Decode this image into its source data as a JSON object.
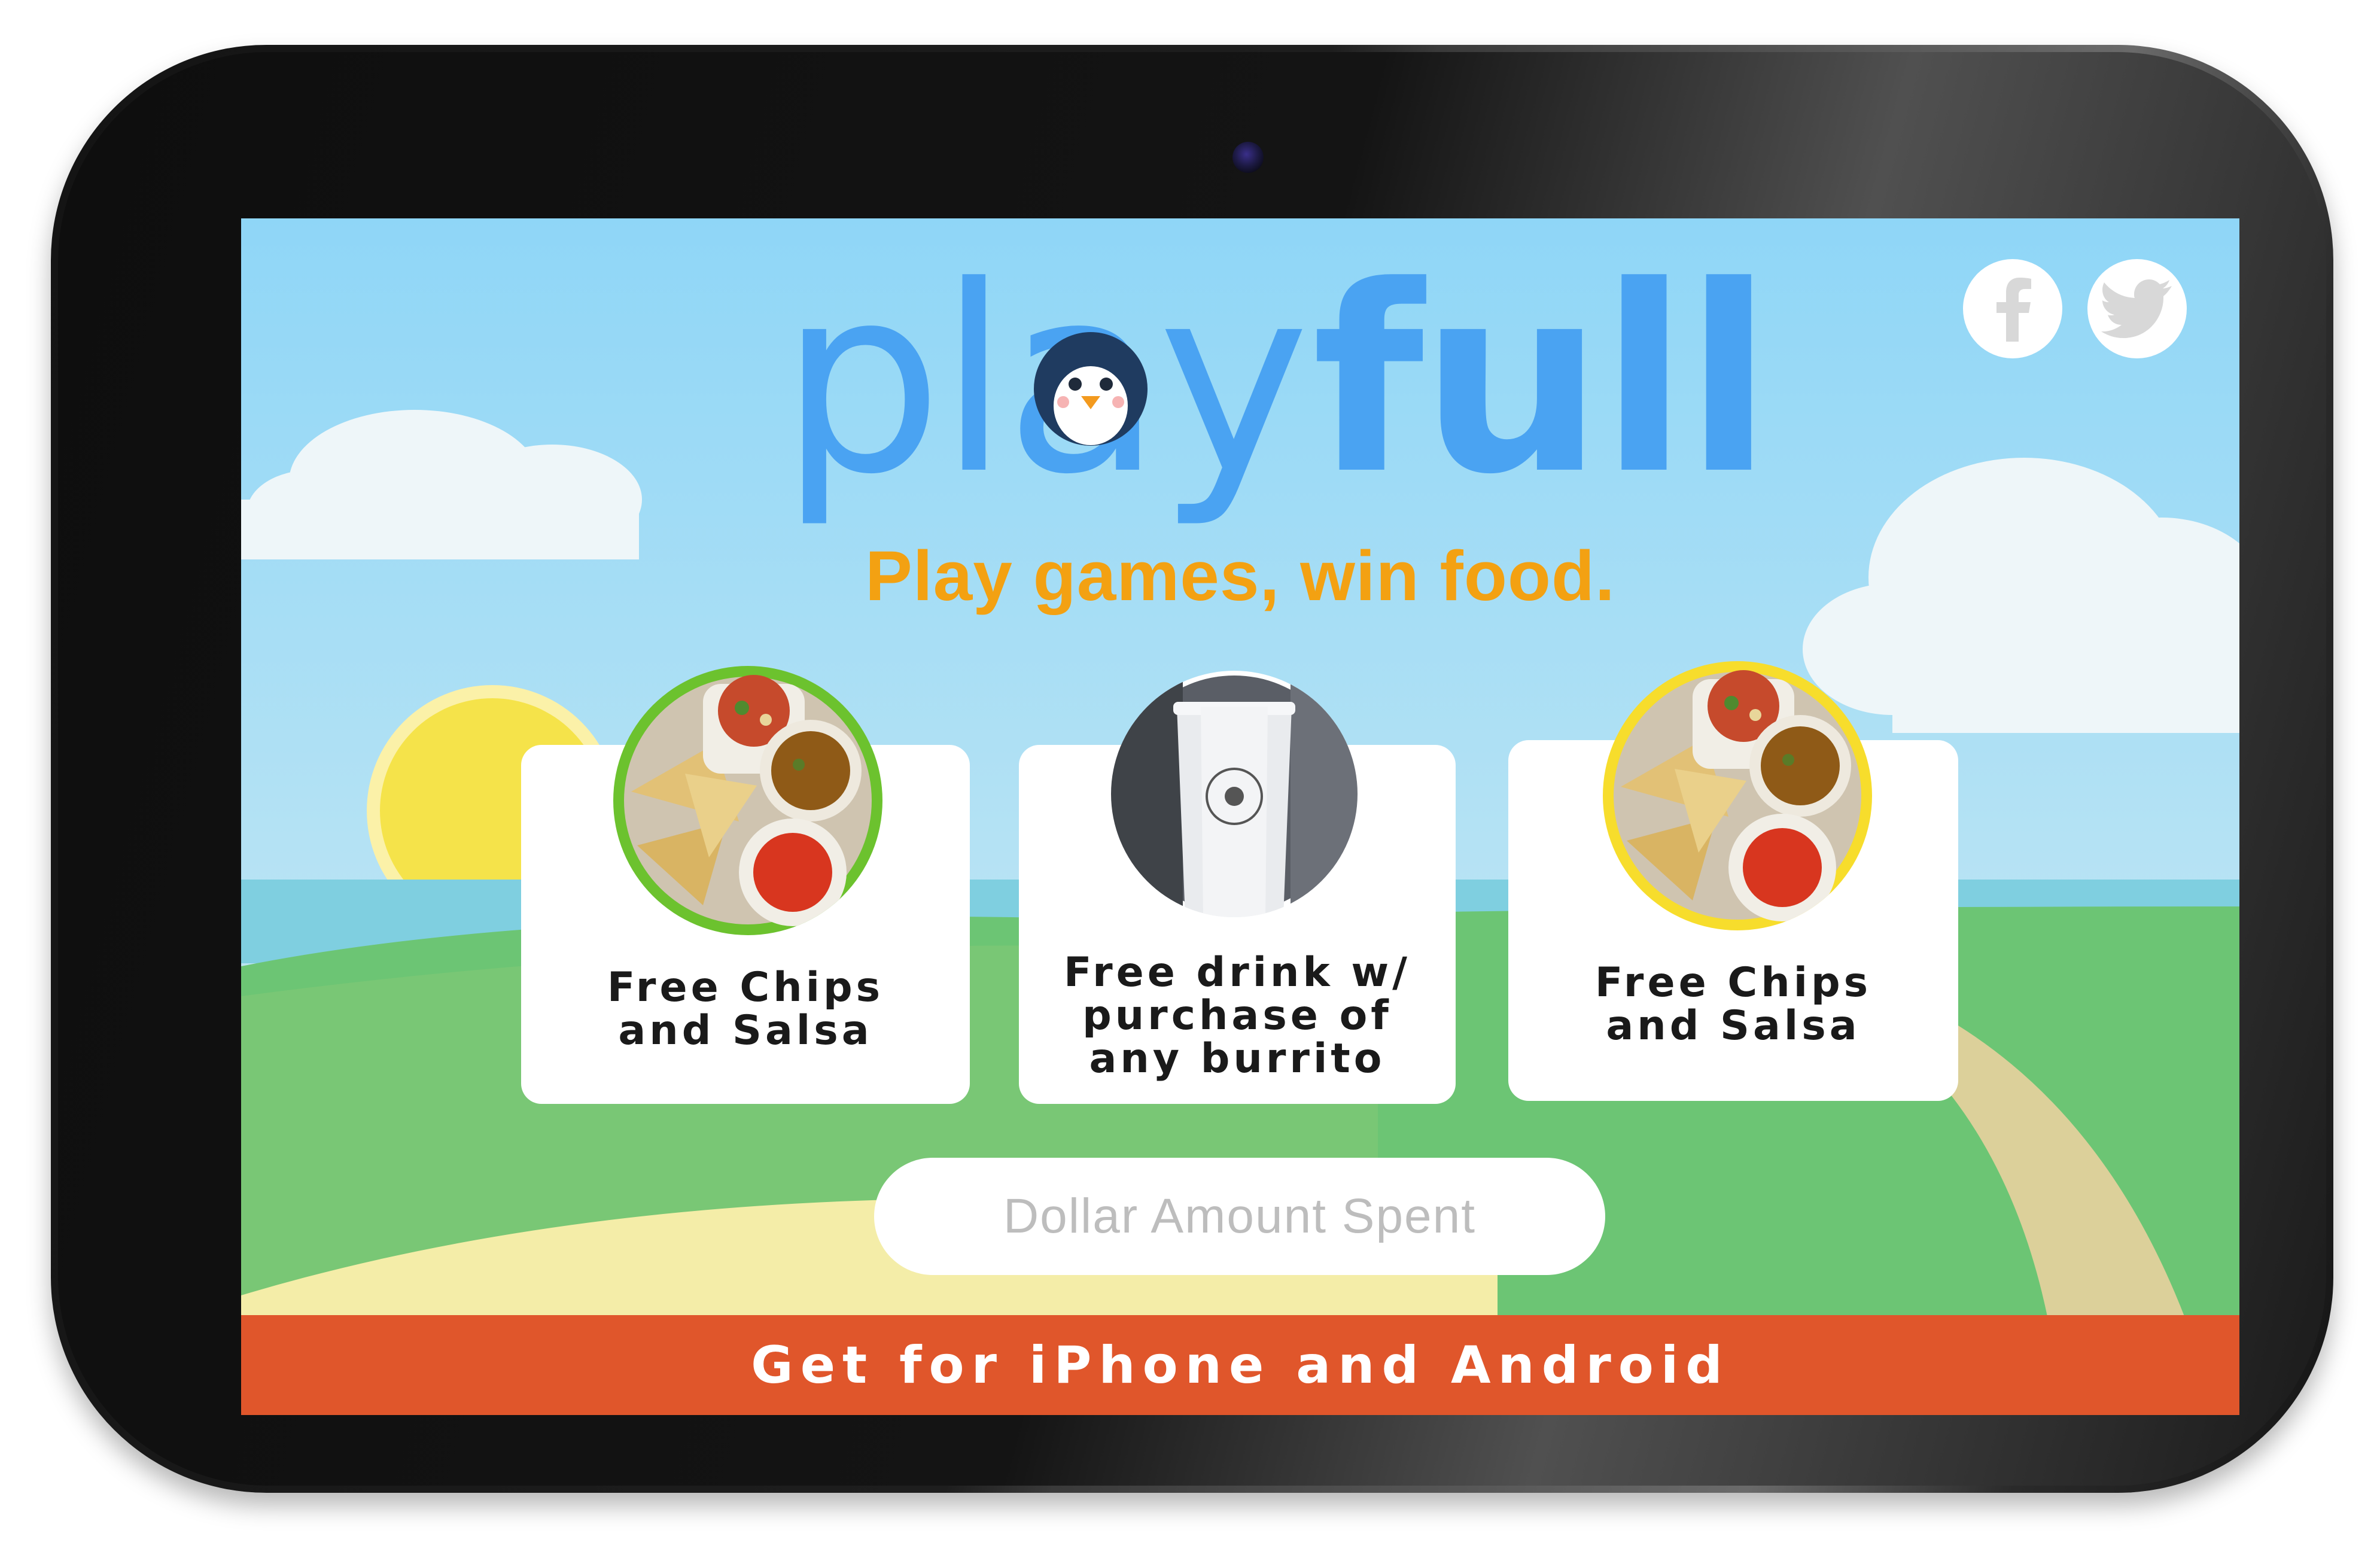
{
  "app": {
    "logo_light": "play",
    "logo_bold": "full",
    "tagline": "Play games, win food."
  },
  "social": {
    "facebook_icon": "facebook-icon",
    "twitter_icon": "twitter-icon"
  },
  "offers": [
    {
      "label_line1": "Free Chips",
      "label_line2": "and Salsa",
      "ring_color": "#6cc22e",
      "photo": "chips-and-salsa-photo"
    },
    {
      "label_line1": "Free drink w/",
      "label_line2": "purchase of",
      "label_line3": "any burrito",
      "ring_color": "#ffffff",
      "photo": "chipotle-cup-photo"
    },
    {
      "label_line1": "Free Chips",
      "label_line2": "and Salsa",
      "ring_color": "#f7dd2c",
      "photo": "chips-and-salsa-photo"
    }
  ],
  "amount_input": {
    "placeholder": "Dollar Amount Spent",
    "value": ""
  },
  "cta": {
    "label": "Get for iPhone and Android"
  },
  "colors": {
    "logo_blue": "#4aa3f2",
    "tagline_orange": "#f3a112",
    "cta_red": "#e0562b",
    "sky": "#8fd6f4",
    "grass": "#6cc574"
  }
}
